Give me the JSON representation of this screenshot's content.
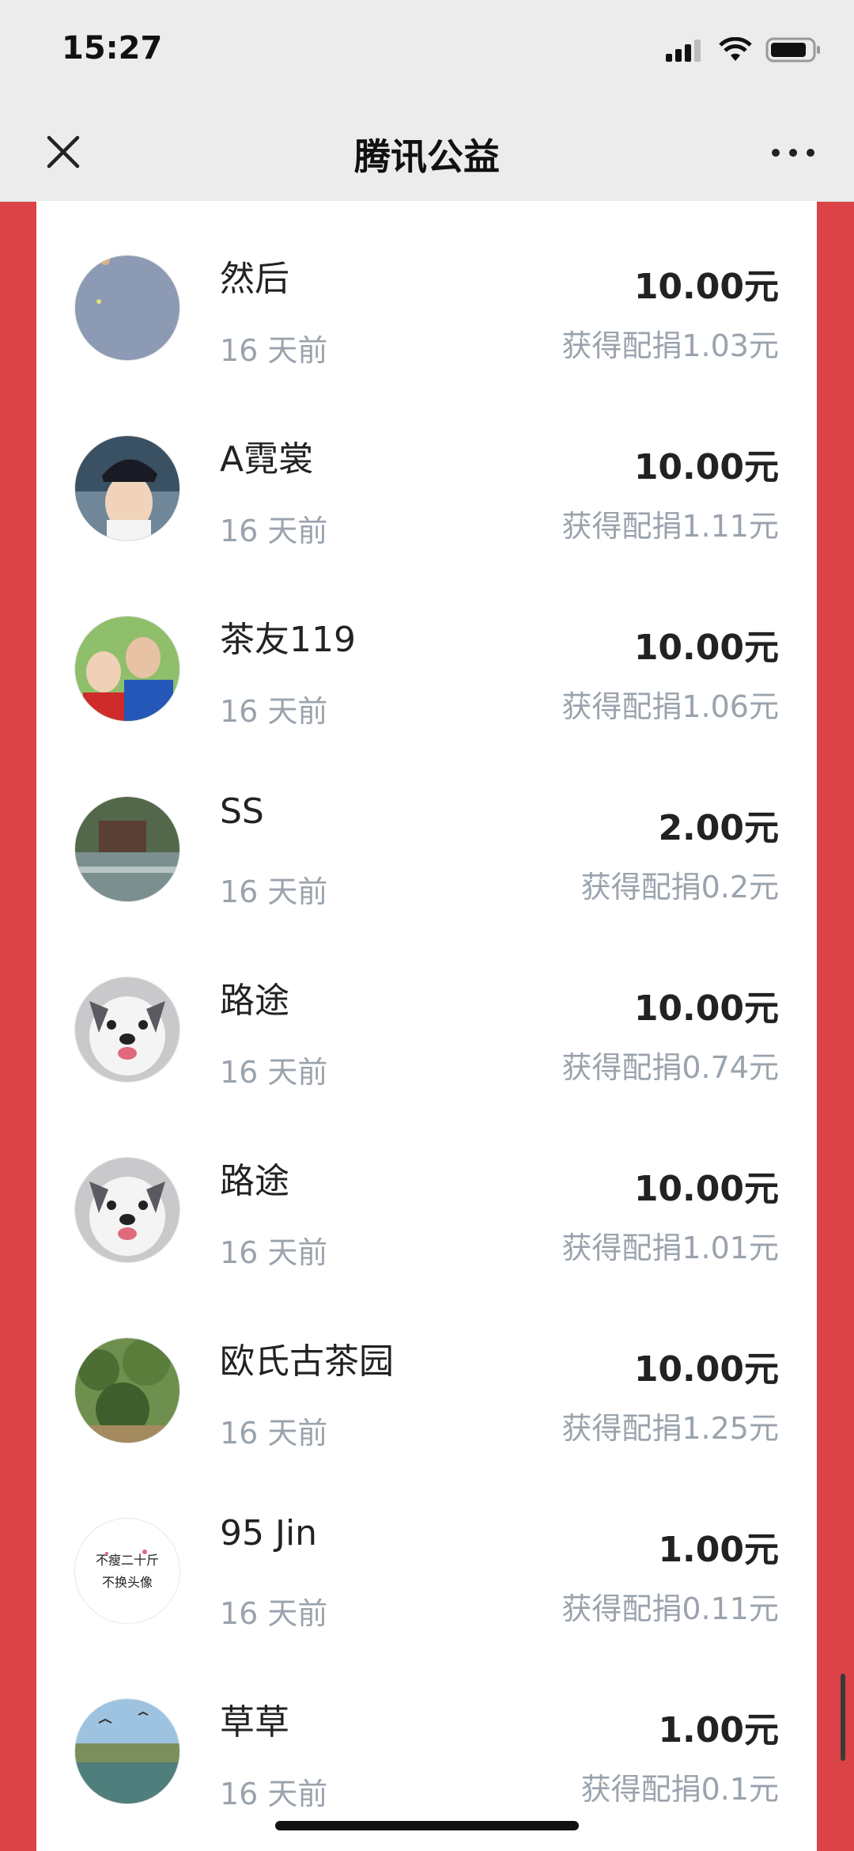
{
  "status_bar": {
    "time": "15:27"
  },
  "nav": {
    "title": "腾讯公益"
  },
  "donations": [
    {
      "name": "然后",
      "ago": "16 天前",
      "amount": "10.00元",
      "match": "获得配捐1.03元",
      "avatar": "avatar-plain-blue"
    },
    {
      "name": "A霓裳",
      "ago": "16 天前",
      "amount": "10.00元",
      "match": "获得配捐1.11元",
      "avatar": "avatar-woman-cap"
    },
    {
      "name": "茶友119",
      "ago": "16 天前",
      "amount": "10.00元",
      "match": "获得配捐1.06元",
      "avatar": "avatar-couple-selfie"
    },
    {
      "name": "SS",
      "ago": "16 天前",
      "amount": "2.00元",
      "match": "获得配捐0.2元",
      "avatar": "avatar-waterside-scene"
    },
    {
      "name": "路途",
      "ago": "16 天前",
      "amount": "10.00元",
      "match": "获得配捐0.74元",
      "avatar": "avatar-husky-dog"
    },
    {
      "name": "路途",
      "ago": "16 天前",
      "amount": "10.00元",
      "match": "获得配捐1.01元",
      "avatar": "avatar-husky-dog"
    },
    {
      "name": "欧氏古茶园",
      "ago": "16 天前",
      "amount": "10.00元",
      "match": "获得配捐1.25元",
      "avatar": "avatar-tea-garden"
    },
    {
      "name": "95 Jin",
      "ago": "16 天前",
      "amount": "1.00元",
      "match": "获得配捐0.11元",
      "avatar": "avatar-text-slogan",
      "avatar_text": [
        "不瘦二十斤",
        "不换头像"
      ]
    },
    {
      "name": "草草",
      "ago": "16 天前",
      "amount": "1.00元",
      "match": "获得配捐0.1元",
      "avatar": "avatar-seaside-birds"
    }
  ],
  "colors": {
    "accent_red": "#dc4346",
    "muted_text": "#9aa3ad",
    "bar_bg": "#ececec"
  }
}
